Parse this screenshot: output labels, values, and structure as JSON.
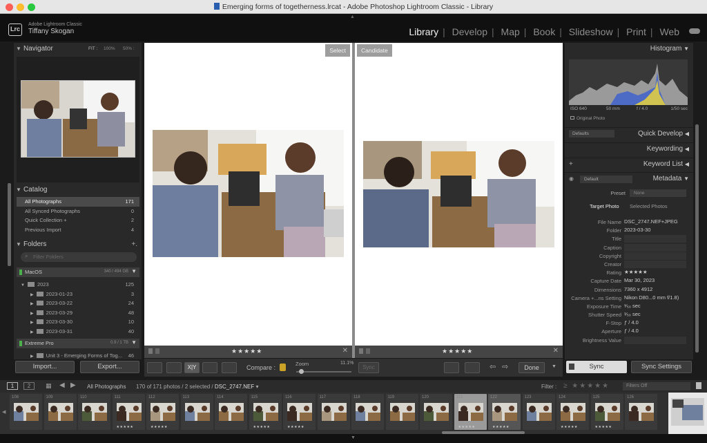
{
  "window": {
    "title": "Emerging forms of togetherness.lrcat - Adobe Photoshop Lightroom Classic - Library"
  },
  "identity": {
    "product": "Adobe Lightroom Classic",
    "user": "Tiffany Skogan",
    "logo": "Lrc"
  },
  "modules": [
    "Library",
    "Develop",
    "Map",
    "Book",
    "Slideshow",
    "Print",
    "Web"
  ],
  "active_module": "Library",
  "navigator": {
    "title": "Navigator",
    "zoom_options": [
      "FIT :",
      "100%",
      "50% :"
    ]
  },
  "catalog": {
    "title": "Catalog",
    "items": [
      {
        "label": "All Photographs",
        "count": "171"
      },
      {
        "label": "All Synced Photographs",
        "count": "0"
      },
      {
        "label": "Quick Collection +",
        "count": "2"
      },
      {
        "label": "Previous Import",
        "count": "4"
      }
    ]
  },
  "folders": {
    "title": "Folders",
    "add": "+.",
    "filter_placeholder": "Filter Folders",
    "volumes": [
      {
        "name": "MacOS",
        "space": "340 / 494 GB"
      },
      {
        "name": "Extreme Pro",
        "space": "0.9 / 1 TB"
      }
    ],
    "tree": [
      {
        "label": "2023",
        "count": "125"
      },
      {
        "label": "2023-01-23",
        "count": "3"
      },
      {
        "label": "2023-03-22",
        "count": "24"
      },
      {
        "label": "2023-03-29",
        "count": "48"
      },
      {
        "label": "2023-03-30",
        "count": "10"
      },
      {
        "label": "2023-03-31",
        "count": "40"
      }
    ],
    "extra": {
      "label": "Unit 3 - Emerging Forms of Tog...",
      "count": "46"
    }
  },
  "buttons": {
    "import": "Import...",
    "export": "Export...",
    "sync": "Sync",
    "sync_settings": "Sync Settings",
    "done": "Done"
  },
  "compare": {
    "select_label": "Select",
    "candidate_label": "Candidate",
    "rating_stars": "★★★★★",
    "compare_label": "Compare :",
    "zoom_label": "Zoom",
    "zoom_value": "11.1%",
    "sync_label": "Sync"
  },
  "right": {
    "histogram": {
      "title": "Histogram",
      "iso": "ISO 640",
      "focal": "50 mm",
      "fstop": "f / 4.0",
      "shutter": "1/50 sec",
      "original_photo": "Original Photo"
    },
    "quick_develop": {
      "title": "Quick Develop",
      "preset": "Defaults"
    },
    "keywording": {
      "title": "Keywording"
    },
    "keyword_list": {
      "title": "Keyword List"
    },
    "metadata": {
      "title": "Metadata",
      "preset_dropdown": "Default",
      "preset_label": "Preset",
      "preset_value": "None",
      "tab_target": "Target Photo",
      "tab_selected": "Selected Photos",
      "fields": [
        {
          "label": "File Name",
          "value": "DSC_2747.NEF+JPEG"
        },
        {
          "label": "Folder",
          "value": "2023-03-30"
        },
        {
          "label": "Title",
          "value": ""
        },
        {
          "label": "Caption",
          "value": ""
        },
        {
          "label": "Copyright",
          "value": ""
        },
        {
          "label": "Creator",
          "value": ""
        },
        {
          "label": "Rating",
          "value": "★★★★★"
        },
        {
          "label": "Capture Date",
          "value": "Mar 30, 2023"
        },
        {
          "label": "Dimensions",
          "value": "7360 x 4912"
        },
        {
          "label": "Camera +...ns Setting",
          "value": "Nikon D80...0 mm f/1.8)"
        },
        {
          "label": "Exposure Time",
          "value": "¹⁄₅₀ sec"
        },
        {
          "label": "Shutter Speed",
          "value": "¹⁄₅₀ sec"
        },
        {
          "label": "F-Stop",
          "value": "ƒ / 4.0"
        },
        {
          "label": "Aperture",
          "value": "ƒ / 4.0"
        },
        {
          "label": "Brightness Value",
          "value": ""
        }
      ]
    }
  },
  "filmstrip_header": {
    "screen1": "1",
    "screen2": "2",
    "source": "All Photographs",
    "status": "170 of 171 photos / 2 selected /",
    "file": "DSC_2747.NEF",
    "filter_label": "Filter :",
    "filter_value": "Filters Off"
  },
  "filmstrip": [
    {
      "num": "108",
      "stars": ""
    },
    {
      "num": "109",
      "stars": ""
    },
    {
      "num": "110",
      "stars": ""
    },
    {
      "num": "111",
      "stars": "★★★★★"
    },
    {
      "num": "112",
      "stars": "★★★★★"
    },
    {
      "num": "113",
      "stars": ""
    },
    {
      "num": "114",
      "stars": ""
    },
    {
      "num": "115",
      "stars": "★★★★★"
    },
    {
      "num": "116",
      "stars": "★★★★★"
    },
    {
      "num": "117",
      "stars": ""
    },
    {
      "num": "118",
      "stars": ""
    },
    {
      "num": "119",
      "stars": ""
    },
    {
      "num": "120",
      "stars": ""
    },
    {
      "num": "121",
      "stars": "★★★★★"
    },
    {
      "num": "122",
      "stars": "★★★★★"
    },
    {
      "num": "123",
      "stars": ""
    },
    {
      "num": "124",
      "stars": "★★★★★"
    },
    {
      "num": "125",
      "stars": "★★★★★"
    },
    {
      "num": "126",
      "stars": ""
    }
  ],
  "colors": {
    "accent_active": "#f0f0f0",
    "panel": "#292929",
    "volume_green": "#4bb04b"
  }
}
